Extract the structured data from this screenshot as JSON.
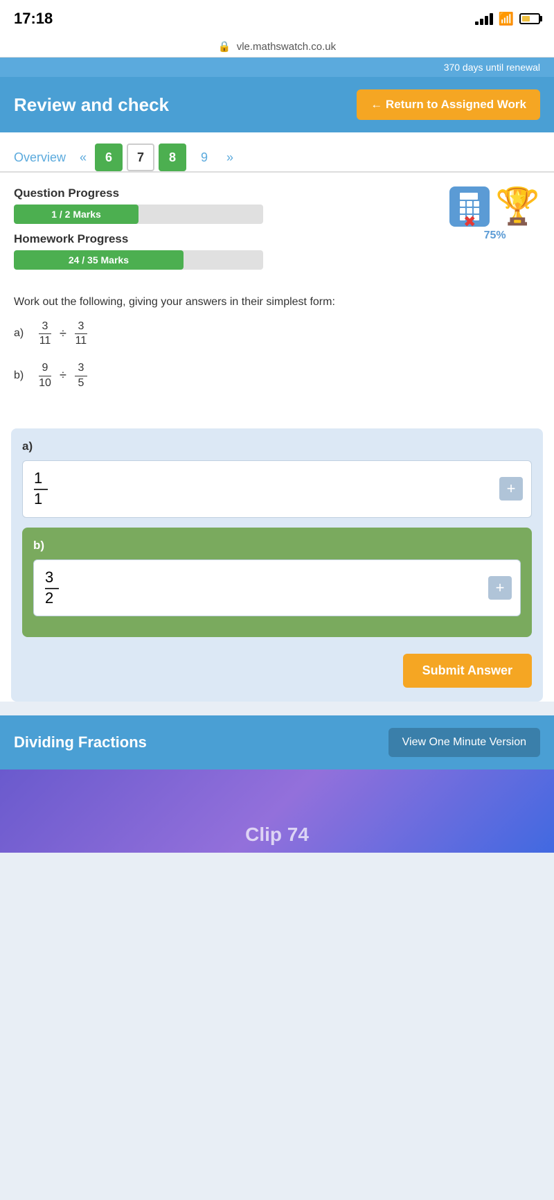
{
  "statusBar": {
    "time": "17:18",
    "url": "vle.mathswatch.co.uk"
  },
  "renewalBanner": {
    "text": "370 days until renewal"
  },
  "header": {
    "title": "Review and check",
    "returnButton": "← Return to Assigned Work"
  },
  "tabs": {
    "overview": "Overview",
    "navPrev": "«",
    "navNext": "»",
    "items": [
      {
        "label": "6",
        "state": "green"
      },
      {
        "label": "7",
        "state": "active"
      },
      {
        "label": "8",
        "state": "green"
      },
      {
        "label": "9",
        "state": "blue"
      }
    ]
  },
  "progress": {
    "questionLabel": "Question Progress",
    "questionValue": "1 / 2 Marks",
    "questionPercent": 50,
    "homeworkLabel": "Homework Progress",
    "homeworkValue": "24 / 35 Marks",
    "homeworkPercent": 68,
    "trophyPercent": "75%"
  },
  "question": {
    "instruction": "Work out the following, giving your answers in their simplest form:",
    "partA": {
      "label": "a)",
      "frac1Num": "3",
      "frac1Den": "11",
      "operator": "÷",
      "frac2Num": "3",
      "frac2Den": "11"
    },
    "partB": {
      "label": "b)",
      "frac1Num": "9",
      "frac1Den": "10",
      "operator": "÷",
      "frac2Num": "3",
      "frac2Den": "5"
    }
  },
  "answerSection": {
    "partALabel": "a)",
    "partANum": "1",
    "partADen": "1",
    "partBLabel": "b)",
    "partBNum": "3",
    "partBDen": "2",
    "submitButton": "Submit Answer"
  },
  "bottomBar": {
    "title": "Dividing Fractions",
    "viewButton": "View One Minute Version"
  },
  "videoWatermark": "Clip 74"
}
